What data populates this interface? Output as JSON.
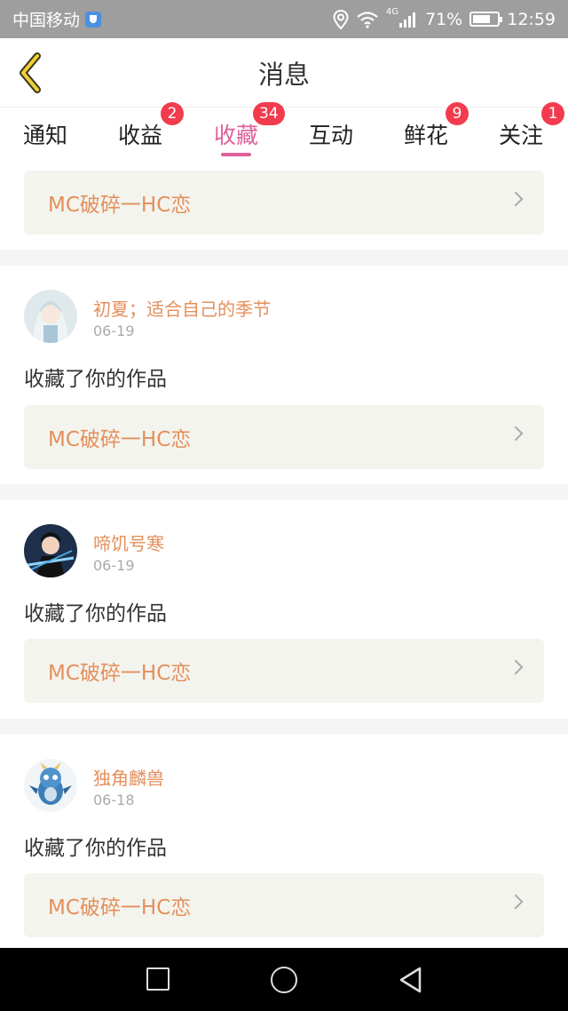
{
  "status_bar": {
    "carrier": "中国移动",
    "network": "4G",
    "battery": "71%",
    "battery_level": 0.71,
    "time": "12:59"
  },
  "header": {
    "title": "消息",
    "back_icon": "chevron-left-icon"
  },
  "tabs": [
    {
      "label": "通知",
      "badge": ""
    },
    {
      "label": "收益",
      "badge": "2"
    },
    {
      "label": "收藏",
      "badge": "34",
      "active": true
    },
    {
      "label": "互动",
      "badge": ""
    },
    {
      "label": "鲜花",
      "badge": "9"
    },
    {
      "label": "关注",
      "badge": "1"
    }
  ],
  "messages": [
    {
      "work_title": "MC破碎一HC恋"
    },
    {
      "user": "初夏；适合自己的季节",
      "date": "06-19",
      "text": "收藏了你的作品",
      "work_title": "MC破碎一HC恋"
    },
    {
      "user": "啼饥号寒",
      "date": "06-19",
      "text": "收藏了你的作品",
      "work_title": "MC破碎一HC恋"
    },
    {
      "user": "独角麟兽",
      "date": "06-18",
      "text": "收藏了你的作品",
      "work_title": "MC破碎一HC恋"
    }
  ],
  "colors": {
    "accent": "#e0609a",
    "badge": "#f23c4e",
    "orange_text": "#e38f5c",
    "card_bg": "#f4f4ee"
  },
  "system_nav": {
    "recent_icon": "square-icon",
    "home_icon": "circle-icon",
    "back_icon": "triangle-back-icon"
  }
}
